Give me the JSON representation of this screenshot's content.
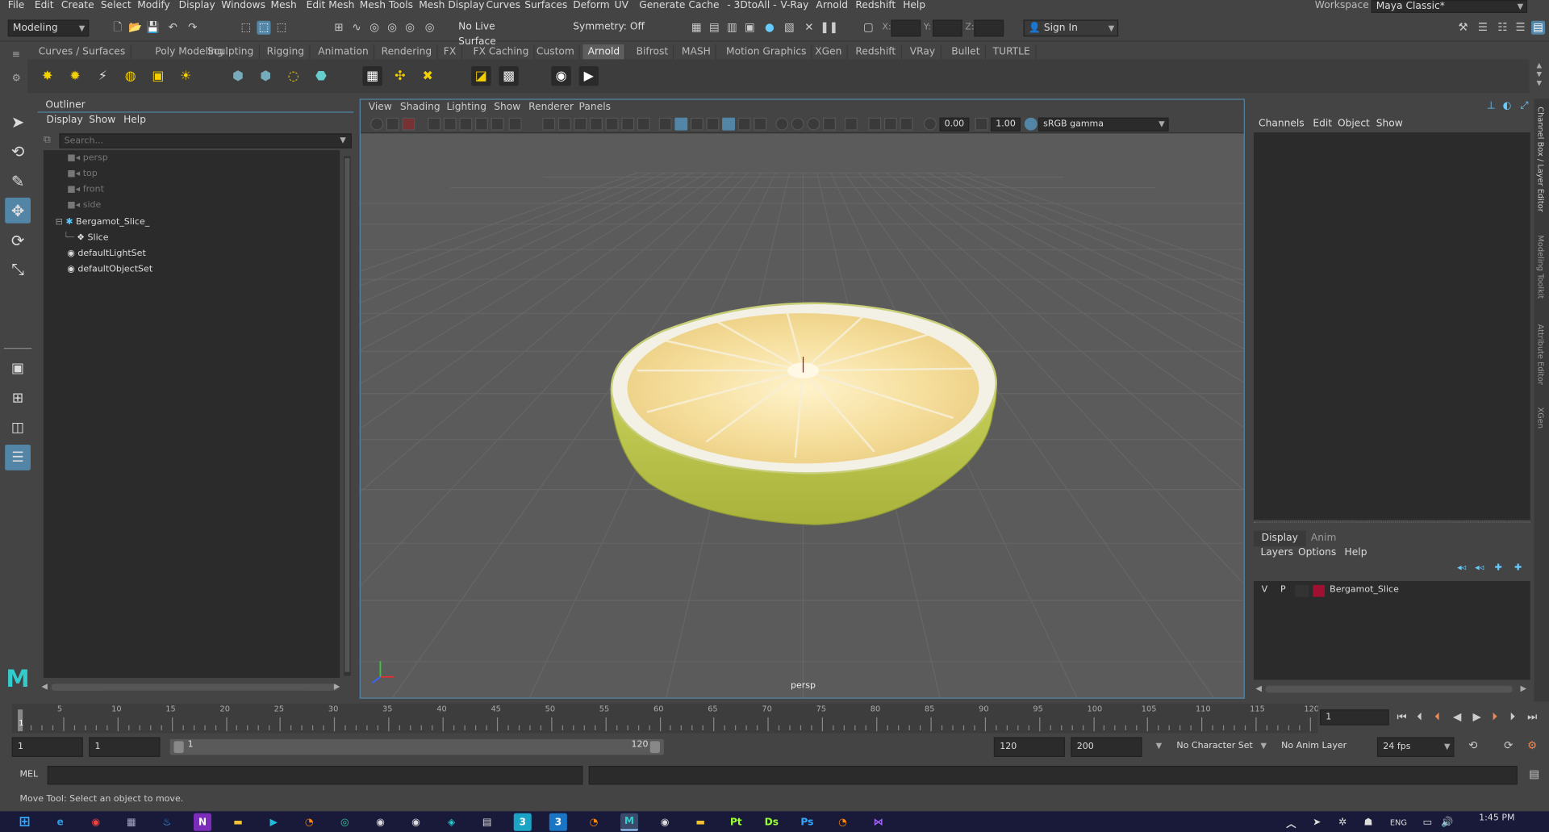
{
  "menu": [
    "File",
    "Edit",
    "Create",
    "Select",
    "Modify",
    "Display",
    "Windows",
    "Mesh",
    "Edit Mesh",
    "Mesh Tools",
    "Mesh Display",
    "Curves",
    "Surfaces",
    "Deform",
    "UV",
    "Generate",
    "Cache",
    "- 3DtoAll -",
    "V-Ray",
    "Arnold",
    "Redshift",
    "Help"
  ],
  "workspace": {
    "label": "Workspace :",
    "value": "Maya Classic*"
  },
  "status": {
    "mode": "Modeling",
    "live_surface": "No Live Surface",
    "symmetry": "Symmetry: Off",
    "x": "X:",
    "y": "Y:",
    "z": "Z:",
    "sign_in": "Sign In"
  },
  "shelf_tabs": [
    "Curves / Surfaces",
    "Poly Modeling",
    "Sculpting",
    "Rigging",
    "Animation",
    "Rendering",
    "FX",
    "FX Caching",
    "Custom",
    "Arnold",
    "Bifrost",
    "MASH",
    "Motion Graphics",
    "XGen",
    "Redshift",
    "VRay",
    "Bullet",
    "TURTLE"
  ],
  "active_shelf": "Arnold",
  "outliner": {
    "title": "Outliner",
    "menu": [
      "Display",
      "Show",
      "Help"
    ],
    "search_placeholder": "Search...",
    "items": [
      {
        "label": "persp",
        "kind": "camera"
      },
      {
        "label": "top",
        "kind": "camera"
      },
      {
        "label": "front",
        "kind": "camera"
      },
      {
        "label": "side",
        "kind": "camera"
      },
      {
        "label": "Bergamot_Slice_",
        "kind": "group"
      },
      {
        "label": "Slice",
        "kind": "mesh"
      },
      {
        "label": "defaultLightSet",
        "kind": "set"
      },
      {
        "label": "defaultObjectSet",
        "kind": "set"
      }
    ]
  },
  "viewport": {
    "menu": [
      "View",
      "Shading",
      "Lighting",
      "Show",
      "Renderer",
      "Panels"
    ],
    "exposure": "0.00",
    "gamma": "1.00",
    "color_space": "sRGB gamma",
    "camera_label": "persp"
  },
  "channel_box": {
    "menu": [
      "Channels",
      "Edit",
      "Object",
      "Show"
    ]
  },
  "right_tabs": [
    "Channel Box / Layer Editor",
    "Modeling Toolkit",
    "Attribute Editor",
    "XGen"
  ],
  "layer_editor": {
    "tabs": [
      "Display",
      "Anim"
    ],
    "active_tab": "Display",
    "menu": [
      "Layers",
      "Options",
      "Help"
    ],
    "layer": {
      "v": "V",
      "p": "P",
      "name": "Bergamot_Slice",
      "color": "#a01030"
    }
  },
  "timeline": {
    "ticks": [
      "5",
      "10",
      "15",
      "20",
      "25",
      "30",
      "35",
      "40",
      "45",
      "50",
      "55",
      "60",
      "65",
      "70",
      "75",
      "80",
      "85",
      "90",
      "95",
      "100",
      "105",
      "110",
      "115",
      "120"
    ],
    "start_label": "1",
    "current_frame": "1"
  },
  "range": {
    "start": "1",
    "playback_start": "1",
    "slider_start": "1",
    "slider_end": "120",
    "playback_end": "120",
    "end": "200",
    "character_set": "No Character Set",
    "anim_layer": "No Anim Layer",
    "fps": "24 fps"
  },
  "command": {
    "label": "MEL"
  },
  "help_line": "Move Tool: Select an object to move.",
  "taskbar": {
    "lang": "ENG",
    "time": "1:45 PM"
  }
}
